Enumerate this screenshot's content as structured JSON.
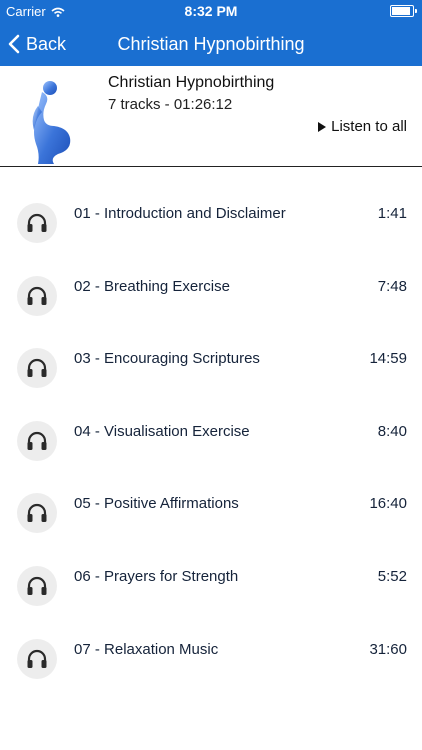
{
  "status_bar": {
    "carrier": "Carrier",
    "time": "8:32 PM"
  },
  "nav": {
    "back_label": "Back",
    "title": "Christian Hypnobirthing"
  },
  "album": {
    "title": "Christian Hypnobirthing",
    "meta": "7 tracks - 01:26:12",
    "listen_all_label": "Listen to all"
  },
  "colors": {
    "nav_bar": "#1a6fd1",
    "artwork": "#3b74d9",
    "icon_circle": "#ededed"
  },
  "tracks": [
    {
      "name": "01 - Introduction and Disclaimer",
      "duration": "1:41"
    },
    {
      "name": "02 - Breathing Exercise",
      "duration": "7:48"
    },
    {
      "name": "03 - Encouraging Scriptures",
      "duration": "14:59"
    },
    {
      "name": "04 - Visualisation Exercise",
      "duration": "8:40"
    },
    {
      "name": "05 - Positive Affirmations",
      "duration": "16:40"
    },
    {
      "name": "06 - Prayers for Strength",
      "duration": "5:52"
    },
    {
      "name": "07 - Relaxation Music",
      "duration": "31:60"
    }
  ]
}
